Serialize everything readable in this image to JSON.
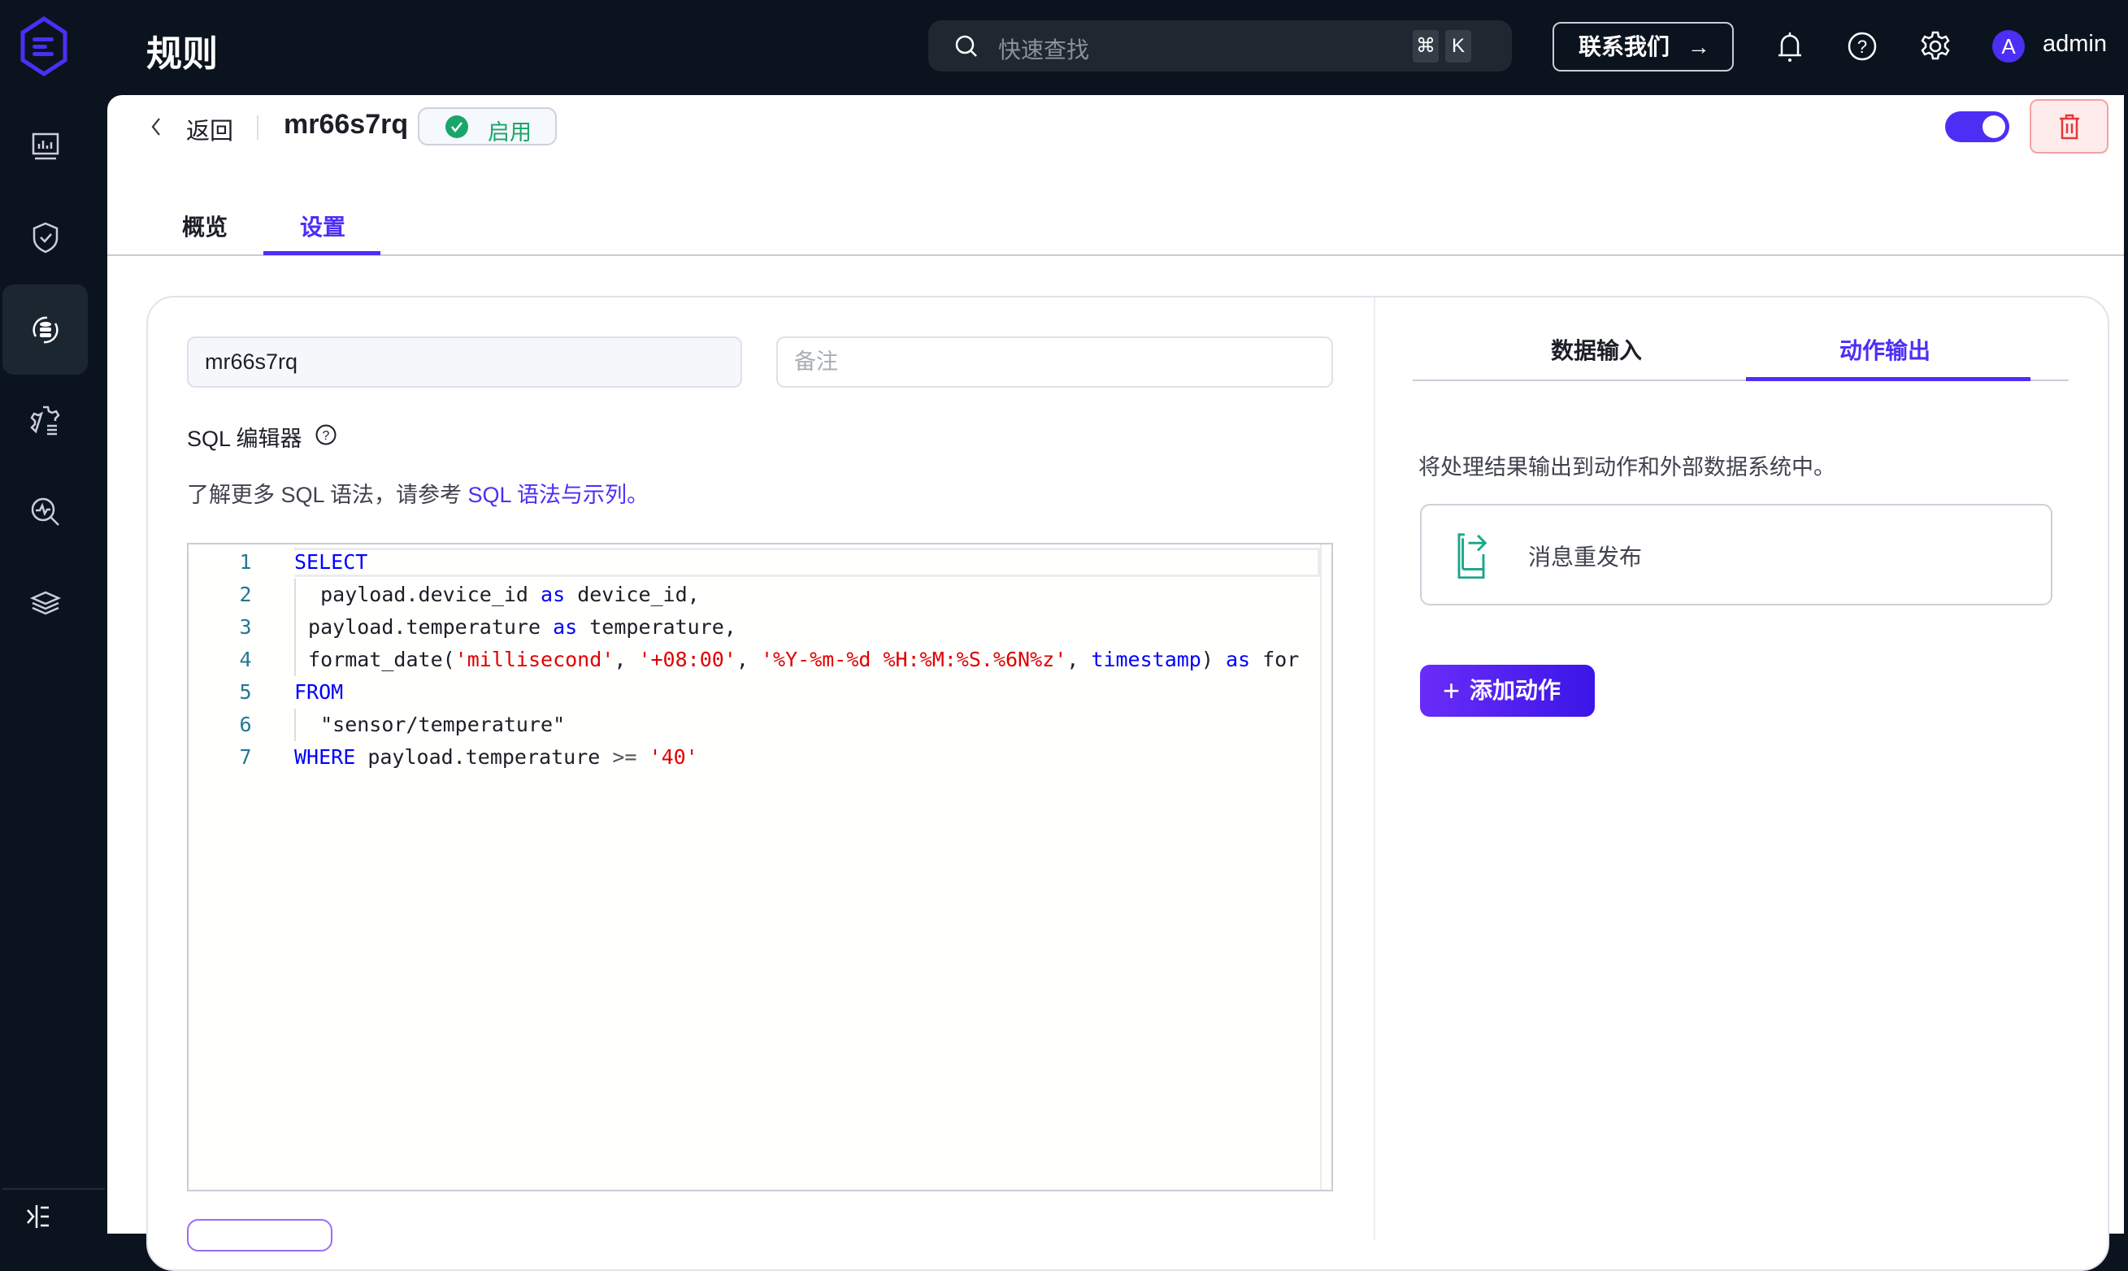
{
  "header": {
    "title": "规则",
    "search_placeholder": "快速查找",
    "shortcut_cmd": "⌘",
    "shortcut_key": "K",
    "contact_label": "联系我们",
    "contact_arrow": "→",
    "avatar_initial": "A",
    "username": "admin"
  },
  "rule": {
    "back_label": "返回",
    "name": "mr66s7rq",
    "status": "启用",
    "enabled": true
  },
  "tabs": [
    {
      "label": "概览",
      "active": false
    },
    {
      "label": "设置",
      "active": true
    }
  ],
  "form": {
    "name_value": "mr66s7rq",
    "note_placeholder": "备注",
    "sql_label": "SQL 编辑器",
    "hint_prefix": "了解更多 SQL 语法，请参考 ",
    "hint_link": "SQL 语法与示列。"
  },
  "sql_lines": [
    {
      "n": "1",
      "parts": [
        [
          "kw",
          "SELECT"
        ]
      ]
    },
    {
      "n": "2",
      "parts": [
        [
          "",
          "  payload.device_id "
        ],
        [
          "kw",
          "as"
        ],
        [
          "",
          " device_id,"
        ]
      ]
    },
    {
      "n": "3",
      "parts": [
        [
          "",
          " payload.temperature "
        ],
        [
          "kw",
          "as"
        ],
        [
          "",
          " temperature,"
        ]
      ]
    },
    {
      "n": "4",
      "parts": [
        [
          "",
          " format_date("
        ],
        [
          "str",
          "'millisecond'"
        ],
        [
          ",",
          ", "
        ],
        [
          "str",
          "'+08:00'"
        ],
        [
          "",
          ", "
        ],
        [
          "str",
          "'%Y-%m-%d %H:%M:%S.%6N%z'"
        ],
        [
          "",
          ", "
        ],
        [
          "kw",
          "timestamp"
        ],
        [
          "",
          ") "
        ],
        [
          "kw",
          "as"
        ],
        [
          "",
          " for"
        ]
      ]
    },
    {
      "n": "5",
      "parts": [
        [
          "kw",
          "FROM"
        ]
      ]
    },
    {
      "n": "6",
      "parts": [
        [
          "",
          "  \"sensor/temperature\""
        ]
      ]
    },
    {
      "n": "7",
      "parts": [
        [
          "kw",
          "WHERE"
        ],
        [
          "",
          " payload.temperature "
        ],
        [
          "op",
          ">="
        ],
        [
          "",
          " "
        ],
        [
          "str",
          "'40'"
        ]
      ]
    }
  ],
  "right_panel": {
    "tabs": [
      {
        "label": "数据输入",
        "active": false
      },
      {
        "label": "动作输出",
        "active": true
      }
    ],
    "description": "将处理结果输出到动作和外部数据系统中。",
    "actions": [
      {
        "label": "消息重发布"
      }
    ],
    "add_action_label": "添加动作"
  },
  "colors": {
    "accent": "#4b2ff5",
    "success": "#1aa56a",
    "danger": "#e5383b",
    "nav_bg": "#0b141e"
  }
}
